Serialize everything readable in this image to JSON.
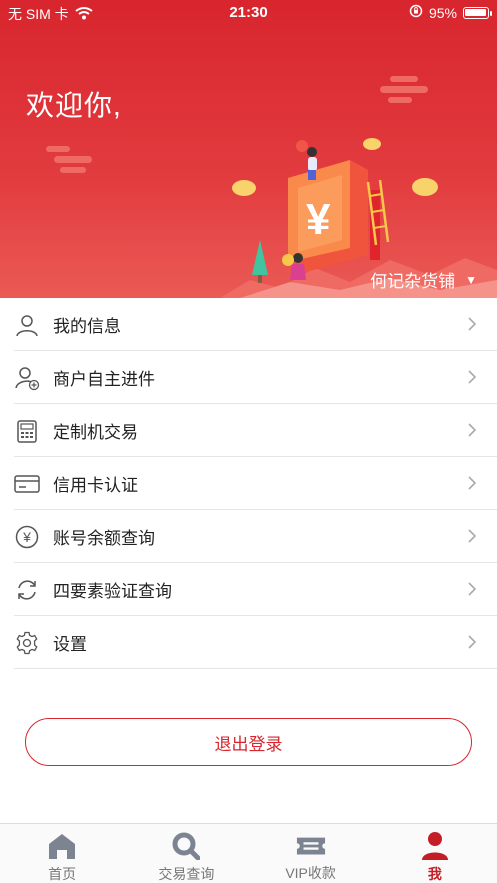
{
  "status_bar": {
    "carrier": "无 SIM 卡",
    "time": "21:30",
    "battery": "95%",
    "battery_level": 0.95
  },
  "header": {
    "welcome": "欢迎你,",
    "merchant_name": "何记杂货铺",
    "merchant_dropdown_icon": "caret-down-icon",
    "colors": {
      "header_bg": "#d8252e",
      "accent": "#d8252e"
    }
  },
  "menu": {
    "items": [
      {
        "label": "我的信息",
        "icon": "user-icon"
      },
      {
        "label": "商户自主进件",
        "icon": "user-add-icon"
      },
      {
        "label": "定制机交易",
        "icon": "pos-terminal-icon"
      },
      {
        "label": "信用卡认证",
        "icon": "credit-card-icon"
      },
      {
        "label": "账号余额查询",
        "icon": "yuan-coin-icon"
      },
      {
        "label": "四要素验证查询",
        "icon": "refresh-icon"
      },
      {
        "label": "设置",
        "icon": "gear-icon"
      }
    ]
  },
  "logout_label": "退出登录",
  "tabbar": {
    "tabs": [
      {
        "label": "首页",
        "icon": "home-icon",
        "active": false
      },
      {
        "label": "交易查询",
        "icon": "search-icon",
        "active": false
      },
      {
        "label": "VIP收款",
        "icon": "ticket-icon",
        "active": false
      },
      {
        "label": "我",
        "icon": "person-icon",
        "active": true
      }
    ]
  }
}
